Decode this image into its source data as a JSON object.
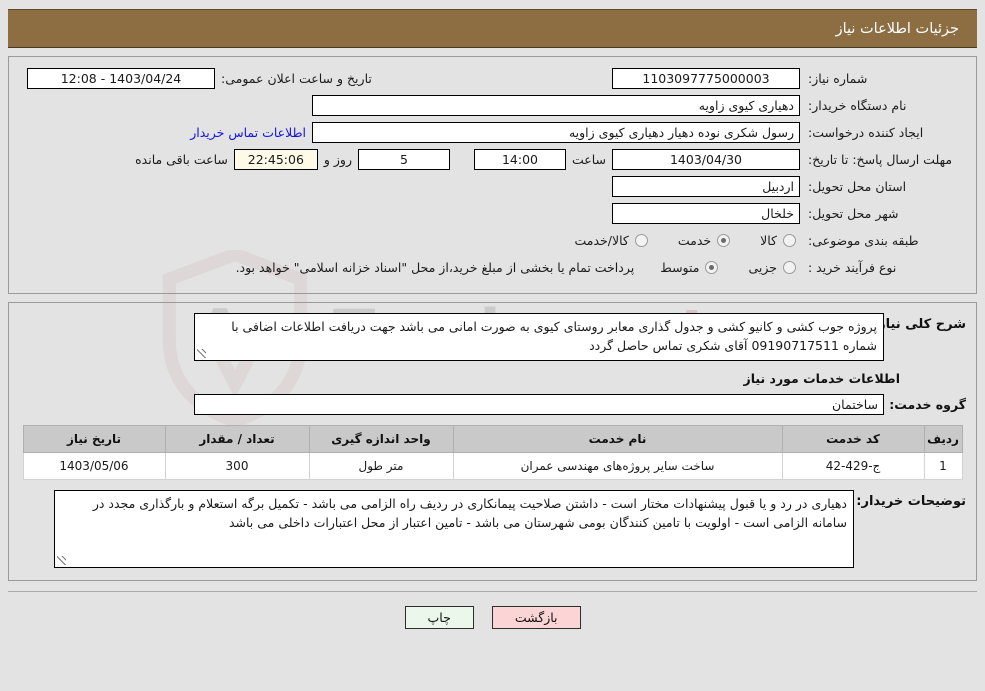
{
  "header": {
    "title": "جزئیات اطلاعات نیاز"
  },
  "colors": {
    "header_bg": "#8d6e42",
    "page_bg": "#e3e3e3",
    "link": "#1414e0",
    "print_btn_bg": "#eaf7ea",
    "back_btn_bg": "#fbd5d5",
    "countdown_bg": "#fdfbe7"
  },
  "fields": {
    "need_number_label": "شماره نیاز:",
    "need_number_value": "1103097775000003",
    "public_announce_label": "تاریخ و ساعت اعلان عمومی:",
    "public_announce_value": "1403/04/24 - 12:08",
    "buyer_org_label": "نام دستگاه خریدار:",
    "buyer_org_value": "دهیاری کیوی زاویه",
    "creator_label": "ایجاد کننده درخواست:",
    "creator_value": "رسول شکری نوده دهیار دهیاری کیوی زاویه",
    "buyer_contact_link": "اطلاعات تماس خریدار",
    "deadline_label": "مهلت ارسال پاسخ: تا تاریخ:",
    "deadline_date": "1403/04/30",
    "deadline_hour_label": "ساعت",
    "deadline_hour": "14:00",
    "remaining_days": "5",
    "remaining_days_label": "روز و",
    "remaining_time": "22:45:06",
    "remaining_time_label": "ساعت باقی مانده",
    "province_label": "استان محل تحویل:",
    "province_value": "اردبیل",
    "city_label": "شهر محل تحویل:",
    "city_value": "خلخال",
    "category_label": "طبقه بندی موضوعی:",
    "process_type_label": "نوع فرآیند خرید :",
    "payment_note": "پرداخت تمام یا بخشی از مبلغ خرید،از محل \"اسناد خزانه اسلامی\" خواهد بود."
  },
  "category_options": [
    {
      "label": "کالا",
      "selected": false
    },
    {
      "label": "خدمت",
      "selected": true
    },
    {
      "label": "کالا/خدمت",
      "selected": false
    }
  ],
  "process_options": [
    {
      "label": "جزیی",
      "selected": false
    },
    {
      "label": "متوسط",
      "selected": true
    }
  ],
  "description": {
    "label": "شرح کلی نیاز:",
    "value": "پروژه جوب کشی و کانیو کشی و جدول گذاری معابر روستای کیوی به صورت امانی می باشد جهت دریافت اطلاعات اضافی با شماره 09190717511 آقای شکری  تماس حاصل گردد"
  },
  "services_section": {
    "title": "اطلاعات خدمات مورد نیاز",
    "group_label": "گروه خدمت:",
    "group_value": "ساختمان"
  },
  "table": {
    "headers": [
      "ردیف",
      "کد خدمت",
      "نام خدمت",
      "واحد اندازه گیری",
      "تعداد / مقدار",
      "تاریخ نیاز"
    ],
    "rows": [
      {
        "index": "1",
        "code": "ج-429-42",
        "name": "ساخت سایر پروژه‌های مهندسی عمران",
        "unit": "متر طول",
        "quantity": "300",
        "need_date": "1403/05/06"
      }
    ]
  },
  "buyer_notes": {
    "label": "توضیحات خریدار:",
    "value": "دهیاری در رد و یا قبول پیشنهادات مختار است - داشتن صلاحیت پیمانکاری در ردیف راه الزامی می باشد - تکمیل برگه استعلام و بارگذاری مجدد در سامانه الزامی است - اولویت با تامین کنندگان بومی شهرستان می باشد - تامین اعتبار از محل اعتبارات داخلی می باشد"
  },
  "buttons": {
    "print": "چاپ",
    "back": "بازگشت"
  },
  "watermark": {
    "text": "AnaTender",
    "suffix": ".net"
  }
}
